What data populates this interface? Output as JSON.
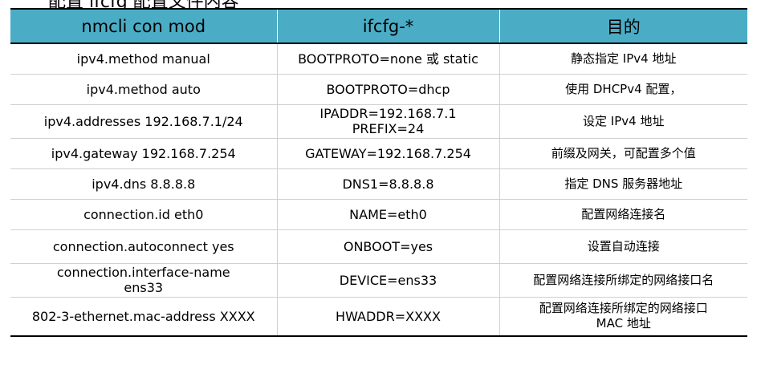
{
  "heading": "配置 ifcfg 配置文件内容",
  "table": {
    "headers": [
      "nmcli con mod",
      "ifcfg-*",
      "目的"
    ],
    "rows": [
      {
        "nmcli": [
          "ipv4.method manual"
        ],
        "ifcfg": [
          "BOOTPROTO=none 或 static"
        ],
        "purpose": [
          "静态指定 IPv4 地址"
        ]
      },
      {
        "nmcli": [
          "ipv4.method auto"
        ],
        "ifcfg": [
          "BOOTPROTO=dhcp"
        ],
        "purpose": [
          "使用 DHCPv4 配置，"
        ]
      },
      {
        "nmcli": [
          "ipv4.addresses 192.168.7.1/24"
        ],
        "ifcfg": [
          "IPADDR=192.168.7.1",
          "PREFIX=24"
        ],
        "purpose": [
          "设定 IPv4 地址"
        ]
      },
      {
        "nmcli": [
          "ipv4.gateway 192.168.7.254"
        ],
        "ifcfg": [
          "GATEWAY=192.168.7.254"
        ],
        "purpose": [
          "前缀及网关，可配置多个值"
        ]
      },
      {
        "nmcli": [
          "ipv4.dns 8.8.8.8"
        ],
        "ifcfg": [
          "DNS1=8.8.8.8"
        ],
        "purpose": [
          "指定 DNS 服务器地址"
        ]
      },
      {
        "nmcli": [
          "connection.id eth0"
        ],
        "ifcfg": [
          "NAME=eth0"
        ],
        "purpose": [
          "配置网络连接名"
        ]
      },
      {
        "nmcli": [
          "connection.autoconnect yes"
        ],
        "ifcfg": [
          "ONBOOT=yes"
        ],
        "purpose": [
          "设置自动连接"
        ]
      },
      {
        "nmcli": [
          "connection.interface-name",
          "ens33"
        ],
        "ifcfg": [
          "DEVICE=ens33"
        ],
        "purpose": [
          "配置网络连接所绑定的网络接口名"
        ]
      },
      {
        "nmcli": [
          "802-3-ethernet.mac-address XXXX"
        ],
        "ifcfg": [
          "HWADDR=XXXX"
        ],
        "purpose": [
          "配置网络连接所绑定的网络接口",
          "MAC 地址"
        ]
      }
    ]
  },
  "colors": {
    "header_bg": "#4bacc6",
    "text": "#000000"
  }
}
